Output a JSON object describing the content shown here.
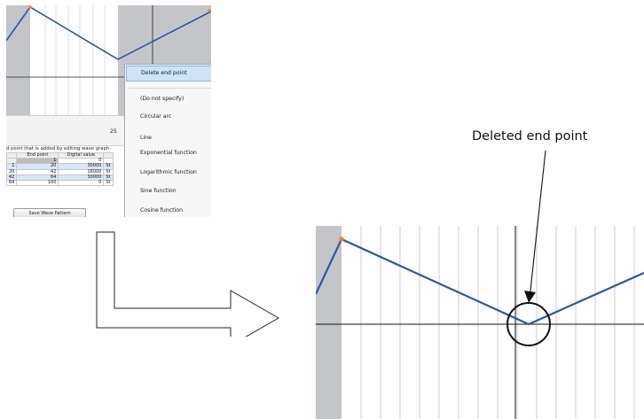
{
  "screenshot": {
    "ruler_value": "25",
    "hint_text": "d point that is added by editing wave graph.",
    "table": {
      "headers": [
        "",
        "End point",
        "Digital value",
        ""
      ],
      "rows": [
        [
          "",
          "1",
          "0",
          ""
        ],
        [
          "1",
          "20",
          "30000",
          "St"
        ],
        [
          "20",
          "42",
          "16000",
          "St"
        ],
        [
          "42",
          "64",
          "30000",
          "St"
        ],
        [
          "64",
          "100",
          "0",
          "St"
        ]
      ]
    },
    "save_button": "Save Wave Pattern",
    "context_menu": {
      "items": [
        "Delete end point",
        "(Do not specify)",
        "Circular arc",
        "Line",
        "Exponential function",
        "Logarithmic function",
        "Sine function",
        "Cosine function"
      ],
      "highlighted": 0
    }
  },
  "callout": {
    "label": "Deleted end point"
  },
  "colors": {
    "waveform": "#2e55a5",
    "end_point_marker": "#e8842a",
    "disabled_region": "#c4c5c9",
    "grid": "#d0d0d0",
    "menu_highlight": "#cde3f7"
  }
}
